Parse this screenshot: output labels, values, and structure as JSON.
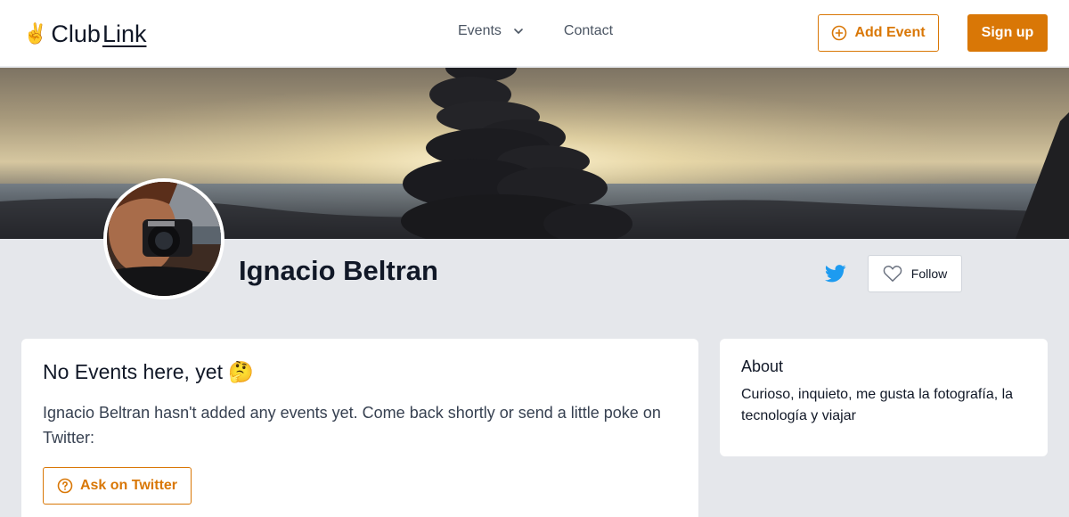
{
  "brand": {
    "name_part1": "Club",
    "name_part2": "Link",
    "emoji": "✌️"
  },
  "nav": {
    "events_label": "Events",
    "contact_label": "Contact"
  },
  "header_actions": {
    "add_event_label": "Add Event",
    "sign_up_label": "Sign up"
  },
  "profile": {
    "name": "Ignacio Beltran",
    "follow_label": "Follow"
  },
  "events_card": {
    "title": "No Events here, yet",
    "emoji": "🤔",
    "message": "Ignacio Beltran hasn't added any events yet. Come back shortly or send a little poke on Twitter:",
    "ask_button_label": "Ask on Twitter"
  },
  "about_card": {
    "title": "About",
    "text": "Curioso, inquieto, me gusta la fotografía, la tecnología y viajar"
  },
  "colors": {
    "accent": "#d97706",
    "page_background": "#e5e7eb",
    "twitter": "#1d9bf0"
  },
  "icons": {
    "nav_chevron": "chevron-down-icon",
    "add_event": "plus-circle-icon",
    "twitter": "twitter-icon",
    "follow": "heart-icon",
    "ask": "question-circle-icon"
  }
}
